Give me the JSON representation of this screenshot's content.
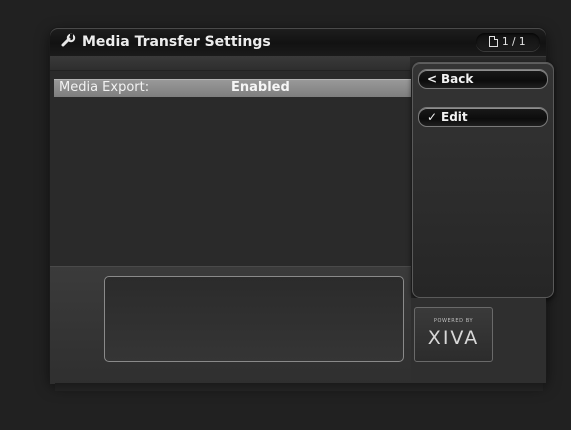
{
  "window": {
    "title": "Media Transfer Settings",
    "title_icon": "wrench-icon",
    "page_indicator": "1 / 1",
    "page_icon": "page-icon"
  },
  "settings": {
    "rows": [
      {
        "label": "Media Export:",
        "value": "Enabled"
      }
    ]
  },
  "menu": {
    "back": {
      "icon": "<",
      "label": "Back"
    },
    "edit": {
      "icon": "✓",
      "label": "Edit"
    }
  },
  "logo": {
    "powered_by": "POWERED BY",
    "brand": "XIVA"
  },
  "colors": {
    "background": "#212121",
    "selected_row": "#8c8c8c",
    "text": "#f2f2f2"
  }
}
